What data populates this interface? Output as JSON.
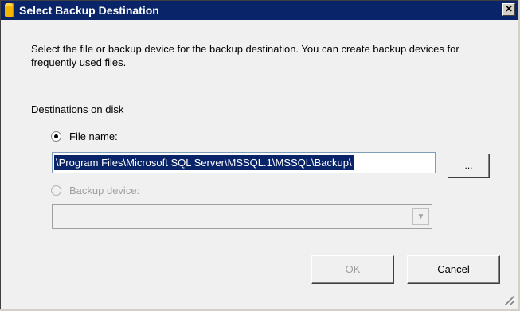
{
  "window": {
    "title": "Select Backup Destination",
    "close_label": "✕"
  },
  "description": "Select the file or backup device for the backup destination. You can create backup devices for frequently used files.",
  "destinations": {
    "label": "Destinations on disk",
    "file_name_label": "File name:",
    "file_name_value": "\\Program Files\\Microsoft SQL Server\\MSSQL.1\\MSSQL\\Backup\\",
    "browse_label": "...",
    "backup_device_label": "Backup device:",
    "backup_device_value": ""
  },
  "buttons": {
    "ok": "OK",
    "cancel": "Cancel"
  },
  "icons": {
    "app": "backup-database-icon",
    "close": "close-icon",
    "dropdown": "chevron-down-icon",
    "resize": "resize-grip-icon"
  }
}
